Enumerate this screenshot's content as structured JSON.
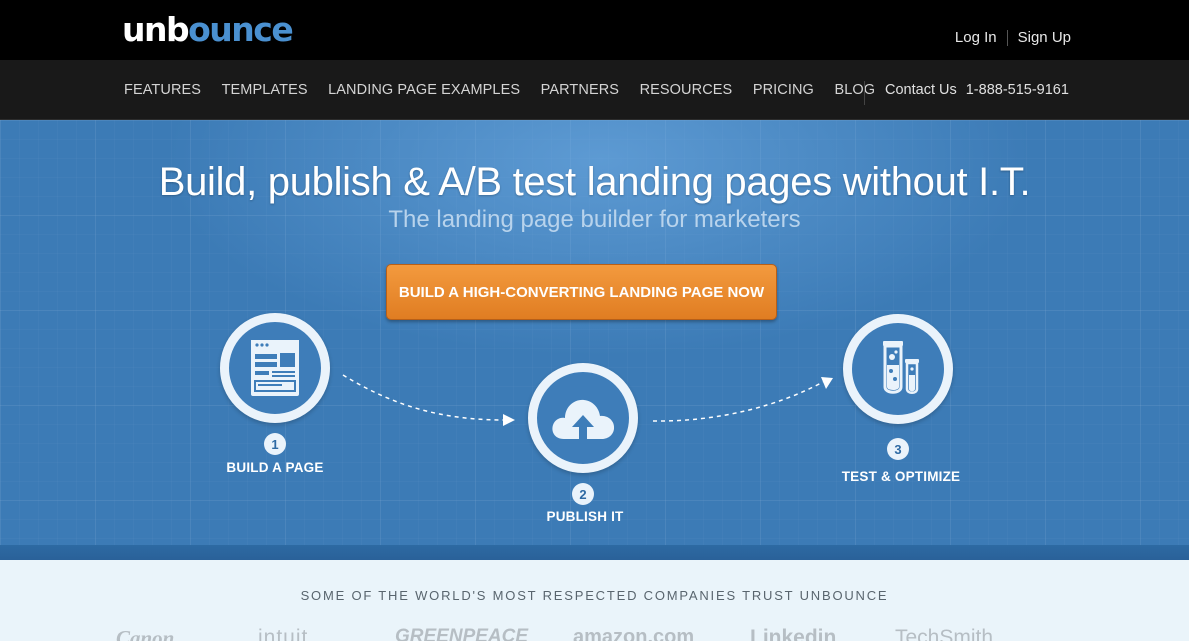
{
  "header": {
    "logo_part1": "unb",
    "logo_part2": "ounce",
    "login": "Log In",
    "signup": "Sign Up"
  },
  "nav": {
    "items": [
      "FEATURES",
      "TEMPLATES",
      "LANDING PAGE EXAMPLES",
      "PARTNERS",
      "RESOURCES",
      "PRICING",
      "BLOG"
    ],
    "contact_label": "Contact Us",
    "phone": "1-888-515-9161"
  },
  "hero": {
    "headline": "Build, publish & A/B test landing pages without I.T.",
    "subheadline": "The landing page builder for marketers",
    "cta": "BUILD A HIGH-CONVERTING LANDING PAGE NOW",
    "steps": [
      {
        "number": "1",
        "label": "BUILD A PAGE",
        "icon": "page-builder-icon"
      },
      {
        "number": "2",
        "label": "PUBLISH IT",
        "icon": "cloud-upload-icon"
      },
      {
        "number": "3",
        "label": "TEST & OPTIMIZE",
        "icon": "test-tubes-icon"
      }
    ]
  },
  "trust": {
    "title": "SOME OF THE WORLD'S MOST RESPECTED COMPANIES TRUST UNBOUNCE",
    "logos": [
      "Canon",
      "intuit",
      "GREENPEACE",
      "amazon.com",
      "Linkedin",
      "TechSmith"
    ]
  },
  "colors": {
    "accent_orange": "#e8862b",
    "hero_blue": "#3c7bb6",
    "logo_blue": "#4a90d0"
  }
}
